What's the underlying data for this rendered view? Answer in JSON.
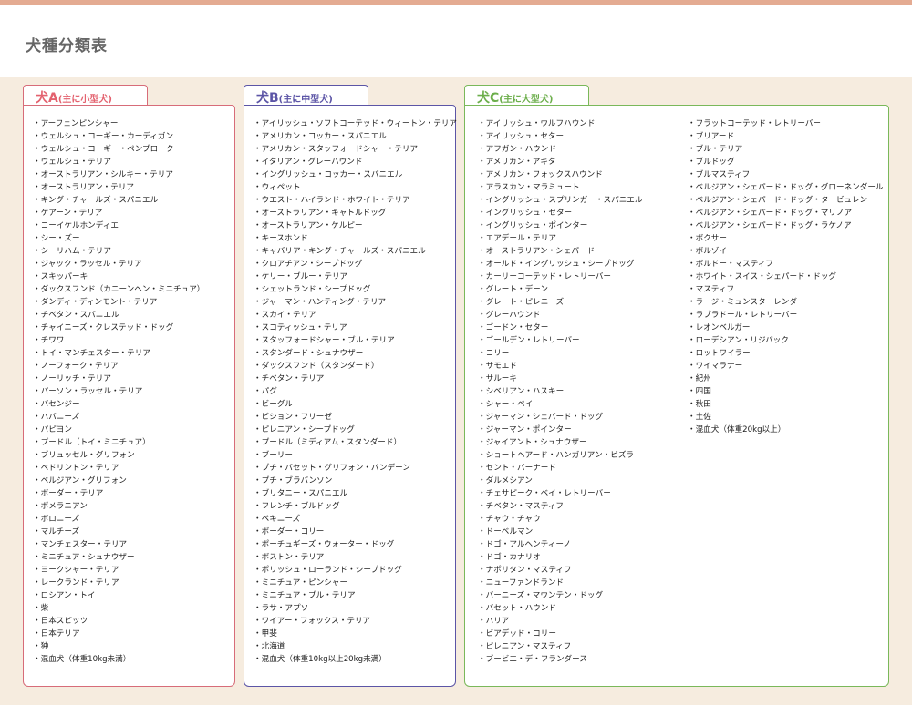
{
  "page": {
    "title": "犬種分類表"
  },
  "colors": {
    "top_bar": "#e4ab92",
    "background": "#f6ecdf",
    "group_a": "#e3626f",
    "group_b": "#5c55a6",
    "group_c": "#6cae4b"
  },
  "groups": {
    "a": {
      "label": "犬A",
      "sub": "(主に小型犬)",
      "items": [
        "・アーフェンピンシャー",
        "・ウェルシュ・コーギー・カーディガン",
        "・ウェルシュ・コーギー・ペンブローク",
        "・ウェルシュ・テリア",
        "・オーストラリアン・シルキー・テリア",
        "・オーストラリアン・テリア",
        "・キング・チャールズ・スパニエル",
        "・ケアーン・テリア",
        "・コーイケルホンディエ",
        "・シー・ズー",
        "・シーリハム・テリア",
        "・ジャック・ラッセル・テリア",
        "・スキッパーキ",
        "・ダックスフンド（カニーンヘン・ミニチュア）",
        "・ダンディ・ディンモント・テリア",
        "・チベタン・スパニエル",
        "・チャイニーズ・クレステッド・ドッグ",
        "・チワワ",
        "・トイ・マンチェスター・テリア",
        "・ノーフォーク・テリア",
        "・ノーリッチ・テリア",
        "・パーソン・ラッセル・テリア",
        "・バセンジー",
        "・ハバニーズ",
        "・パピヨン",
        "・プードル（トイ・ミニチュア）",
        "・ブリュッセル・グリフォン",
        "・ベドリントン・テリア",
        "・ベルジアン・グリフォン",
        "・ボーダー・テリア",
        "・ポメラニアン",
        "・ボロニーズ",
        "・マルチーズ",
        "・マンチェスター・テリア",
        "・ミニチュア・シュナウザー",
        "・ヨークシャー・テリア",
        "・レークランド・テリア",
        "・ロシアン・トイ",
        "・柴",
        "・日本スピッツ",
        "・日本テリア",
        "・狆",
        "・混血犬（体重10kg未満）"
      ]
    },
    "b": {
      "label": "犬B",
      "sub": "(主に中型犬)",
      "items": [
        "・アイリッシュ・ソフトコーテッド・ウィートン・テリア",
        "・アメリカン・コッカー・スパニエル",
        "・アメリカン・スタッフォードシャー・テリア",
        "・イタリアン・グレーハウンド",
        "・イングリッシュ・コッカー・スパニエル",
        "・ウィペット",
        "・ウエスト・ハイランド・ホワイト・テリア",
        "・オーストラリアン・キャトルドッグ",
        "・オーストラリアン・ケルピー",
        "・キースホンド",
        "・キャバリア・キング・チャールズ・スパニエル",
        "・クロアチアン・シープドッグ",
        "・ケリー・ブルー・テリア",
        "・シェットランド・シープドッグ",
        "・ジャーマン・ハンティング・テリア",
        "・スカイ・テリア",
        "・スコティッシュ・テリア",
        "・スタッフォードシャー・ブル・テリア",
        "・スタンダード・シュナウザー",
        "・ダックスフンド（スタンダード）",
        "・チベタン・テリア",
        "・パグ",
        "・ビーグル",
        "・ビション・フリーゼ",
        "・ピレニアン・シープドッグ",
        "・プードル（ミディアム・スタンダード）",
        "・ブーリー",
        "・プチ・バセット・グリフォン・バンデーン",
        "・プチ・ブラバンソン",
        "・ブリタニー・スパニエル",
        "・フレンチ・ブルドッグ",
        "・ペキニーズ",
        "・ボーダー・コリー",
        "・ポーチュギーズ・ウォーター・ドッグ",
        "・ボストン・テリア",
        "・ポリッシュ・ローランド・シープドッグ",
        "・ミニチュア・ピンシャー",
        "・ミニチュア・ブル・テリア",
        "・ラサ・アプソ",
        "・ワイアー・フォックス・テリア",
        "・甲斐",
        "・北海道",
        "・混血犬（体重10kg以上20kg未満）"
      ]
    },
    "c": {
      "label": "犬C",
      "sub": "(主に大型犬)",
      "items_col1": [
        "・アイリッシュ・ウルフハウンド",
        "・アイリッシュ・セター",
        "・アフガン・ハウンド",
        "・アメリカン・アキタ",
        "・アメリカン・フォックスハウンド",
        "・アラスカン・マラミュート",
        "・イングリッシュ・スプリンガー・スパニエル",
        "・イングリッシュ・セター",
        "・イングリッシュ・ポインター",
        "・エアデール・テリア",
        "・オーストラリアン・シェパード",
        "・オールド・イングリッシュ・シープドッグ",
        "・カーリーコーテッド・レトリーバー",
        "・グレート・デーン",
        "・グレート・ピレニーズ",
        "・グレーハウンド",
        "・ゴードン・セター",
        "・ゴールデン・レトリーバー",
        "・コリー",
        "・サモエド",
        "・サルーキ",
        "・シベリアン・ハスキー",
        "・シャー・ペイ",
        "・ジャーマン・シェパード・ドッグ",
        "・ジャーマン・ポインター",
        "・ジャイアント・シュナウザー",
        "・ショートヘアード・ハンガリアン・ビズラ",
        "・セント・バーナード",
        "・ダルメシアン",
        "・チェサピーク・ベイ・レトリーバー",
        "・チベタン・マスティフ",
        "・チャウ・チャウ",
        "・ドーベルマン",
        "・ドゴ・アルヘンティーノ",
        "・ドゴ・カナリオ",
        "・ナポリタン・マスティフ",
        "・ニューファンドランド",
        "・バーニーズ・マウンテン・ドッグ",
        "・バセット・ハウンド",
        "・ハリア",
        "・ビアデッド・コリー",
        "・ピレニアン・マスティフ",
        "・ブービエ・デ・フランダース"
      ],
      "items_col2": [
        "・フラットコーテッド・レトリーバー",
        "・ブリアード",
        "・ブル・テリア",
        "・ブルドッグ",
        "・ブルマスティフ",
        "・ベルジアン・シェパード・ドッグ・グローネンダール",
        "・ベルジアン・シェパード・ドッグ・タービュレン",
        "・ベルジアン・シェパード・ドッグ・マリノア",
        "・ベルジアン・シェパード・ドッグ・ラケノア",
        "・ボクサー",
        "・ボルゾイ",
        "・ボルドー・マスティフ",
        "・ホワイト・スイス・シェパード・ドッグ",
        "・マスティフ",
        "・ラージ・ミュンスターレンダー",
        "・ラブラドール・レトリーバー",
        "・レオンベルガー",
        "・ローデシアン・リジバック",
        "・ロットワイラー",
        "・ワイマラナー",
        "・紀州",
        "・四国",
        "・秋田",
        "・土佐",
        "・混血犬（体重20kg以上）"
      ]
    }
  }
}
